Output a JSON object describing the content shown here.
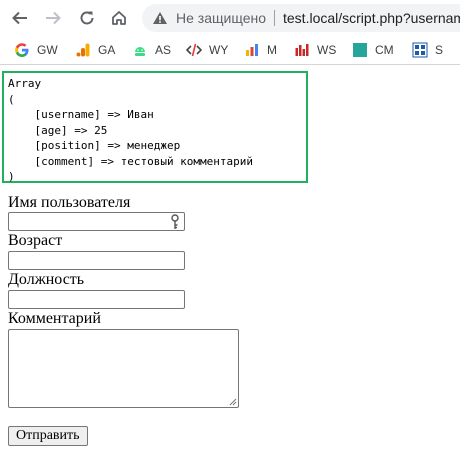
{
  "browser": {
    "security_label": "Не защищено",
    "url": "test.local/script.php?usernam",
    "bookmarks": [
      {
        "label": "GW",
        "icon": "google-icon"
      },
      {
        "label": "GA",
        "icon": "analytics-icon"
      },
      {
        "label": "AS",
        "icon": "android-icon"
      },
      {
        "label": "WY",
        "icon": "code-icon"
      },
      {
        "label": "M",
        "icon": "bookmark-m-icon"
      },
      {
        "label": "WS",
        "icon": "bar-chart-icon"
      },
      {
        "label": "CM",
        "icon": "cm-icon"
      },
      {
        "label": "S",
        "icon": "grid-icon"
      }
    ]
  },
  "dump": {
    "text": "Array\n(\n    [username] => Иван\n    [age] => 25\n    [position] => менеджер\n    [comment] => тестовый комментарий\n)"
  },
  "form": {
    "username_label": "Имя пользователя",
    "username_value": "",
    "age_label": "Возраст",
    "age_value": "",
    "position_label": "Должность",
    "position_value": "",
    "comment_label": "Комментарий",
    "comment_value": "",
    "submit_label": "Отправить"
  },
  "colors": {
    "highlight_border": "#22b060"
  }
}
